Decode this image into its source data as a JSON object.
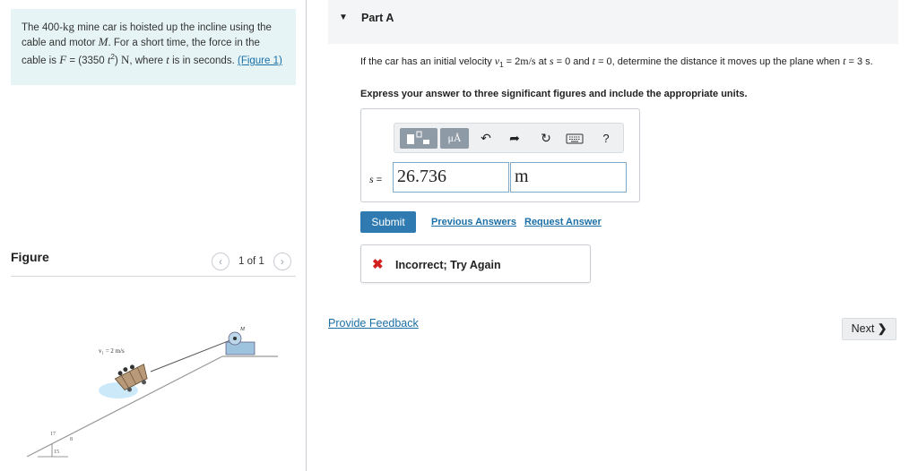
{
  "problem": {
    "t1": "The 400-",
    "kg": "kg",
    "t2": " mine car is hoisted up the incline using the cable and motor ",
    "M": "M",
    "t3": ". For a short time, the force in the cable is ",
    "F": "F",
    "t4": " = (3350 ",
    "t": "t",
    "sq": "2",
    "t5": ") ",
    "N": "N",
    "t6": ", where ",
    "t7": " is in seconds. ",
    "figure_link": "(Figure 1)"
  },
  "figure": {
    "title": "Figure",
    "page_indicator": "1 of 1",
    "prev_icon": "chevron-left-icon",
    "next_icon": "chevron-right-icon",
    "label_velocity": "v₁ = 2 m/s",
    "label_motor": "M",
    "label_17": "17",
    "label_8": "8",
    "label_15": "15"
  },
  "part": {
    "caret_icon": "caret-down-icon",
    "title": "Part A"
  },
  "question": {
    "q1": "If the car has an initial velocity ",
    "v1": "v",
    "sub1": "1",
    "q2": " = 2",
    "unit1": "m/s",
    "q3": " at ",
    "s": "s",
    "q4": " = 0 and ",
    "t": "t",
    "q5": " = 0, determine the distance it moves up the plane when ",
    "q6": " = 3 ",
    "unit2": "s",
    "q7": ".",
    "instruction": "Express your answer to three significant figures and include the appropriate units."
  },
  "toolbar": {
    "units_label": "μÅ",
    "undo_icon": "undo-icon",
    "redo_icon": "redo-icon",
    "reset_icon": "reset-icon",
    "keyboard_icon": "keyboard-icon",
    "help_label": "?"
  },
  "answer": {
    "label_var": "s",
    "label_eq": " =",
    "value": "26.736",
    "unit": "m"
  },
  "actions": {
    "submit": "Submit",
    "previous_answers": "Previous Answers",
    "request_answer": "Request Answer"
  },
  "feedback": {
    "icon": "x-icon",
    "x_glyph": "✖",
    "message": "Incorrect; Try Again"
  },
  "footer": {
    "provide_feedback": "Provide Feedback",
    "next": "Next",
    "next_glyph": "❯"
  },
  "colors": {
    "accent": "#2f7ab0",
    "link": "#1a6fa8",
    "error": "#d21f1f",
    "problem_bg": "#e6f4f5"
  }
}
